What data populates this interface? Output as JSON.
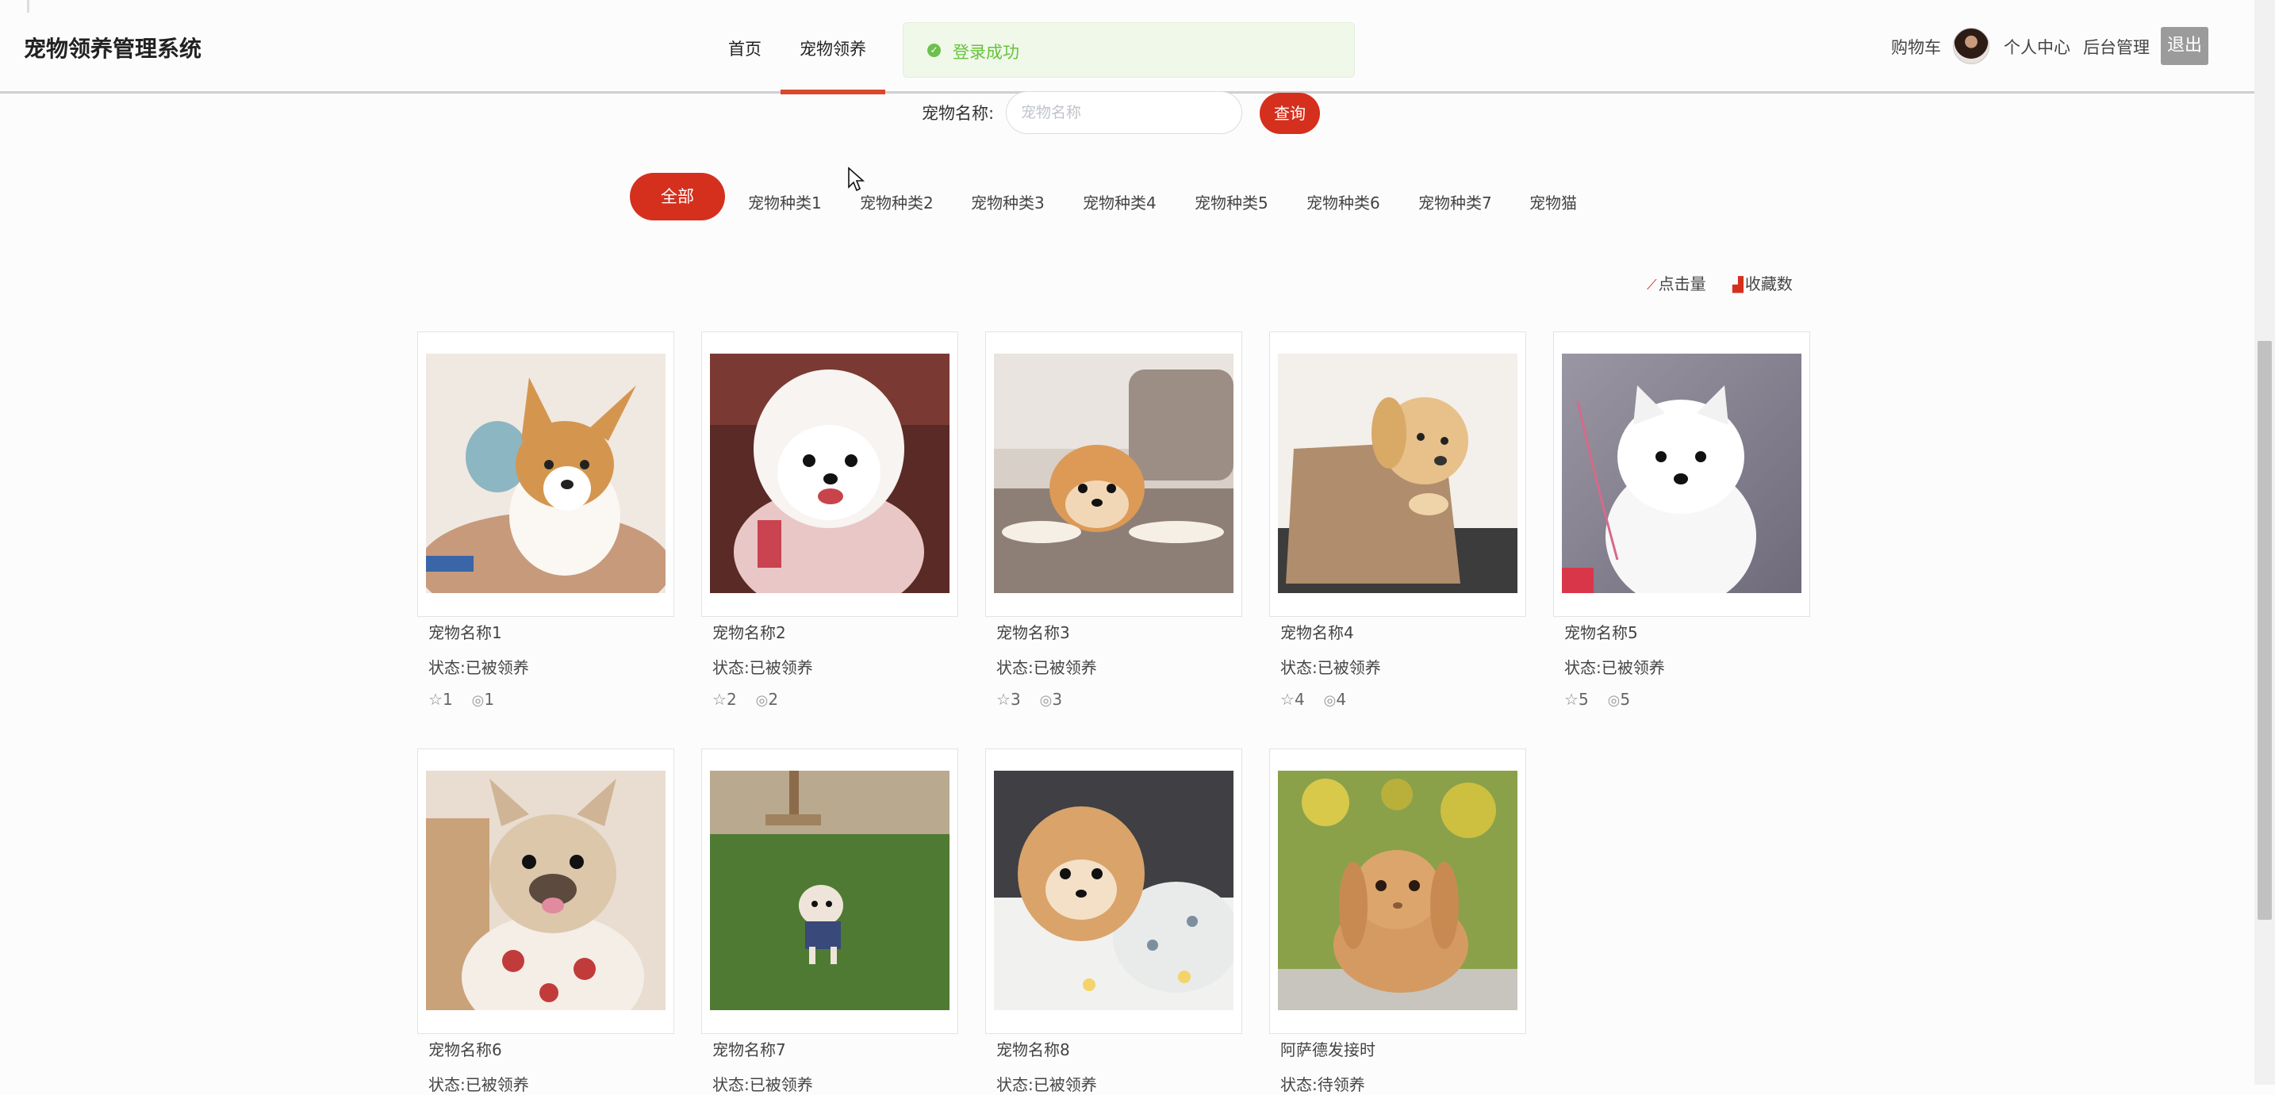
{
  "header": {
    "brand": "宠物领养管理系统",
    "nav": [
      {
        "label": "首页"
      },
      {
        "label": "宠物领养"
      }
    ],
    "toast": "登录成功",
    "cart": "购物车",
    "profile": "个人中心",
    "admin": "后台管理",
    "logout": "退出"
  },
  "search": {
    "label": "宠物名称:",
    "placeholder": "宠物名称",
    "button": "查询"
  },
  "categories": {
    "all": "全部",
    "items": [
      "宠物种类1",
      "宠物种类2",
      "宠物种类3",
      "宠物种类4",
      "宠物种类5",
      "宠物种类6",
      "宠物种类7",
      "宠物猫"
    ]
  },
  "sort": {
    "clicks": "点击量",
    "favorites": "收藏数"
  },
  "pets": [
    {
      "name": "宠物名称1",
      "status": "状态:已被领养",
      "favorites": "1",
      "views": "1"
    },
    {
      "name": "宠物名称2",
      "status": "状态:已被领养",
      "favorites": "2",
      "views": "2"
    },
    {
      "name": "宠物名称3",
      "status": "状态:已被领养",
      "favorites": "3",
      "views": "3"
    },
    {
      "name": "宠物名称4",
      "status": "状态:已被领养",
      "favorites": "4",
      "views": "4"
    },
    {
      "name": "宠物名称5",
      "status": "状态:已被领养",
      "favorites": "5",
      "views": "5"
    },
    {
      "name": "宠物名称6",
      "status": "状态:已被领养"
    },
    {
      "name": "宠物名称7",
      "status": "状态:已被领养"
    },
    {
      "name": "宠物名称8",
      "status": "状态:已被领养"
    },
    {
      "name": "阿萨德发接时",
      "status": "状态:待领养"
    }
  ],
  "colors": {
    "accent": "#d5301d",
    "success": "#67c23a"
  }
}
